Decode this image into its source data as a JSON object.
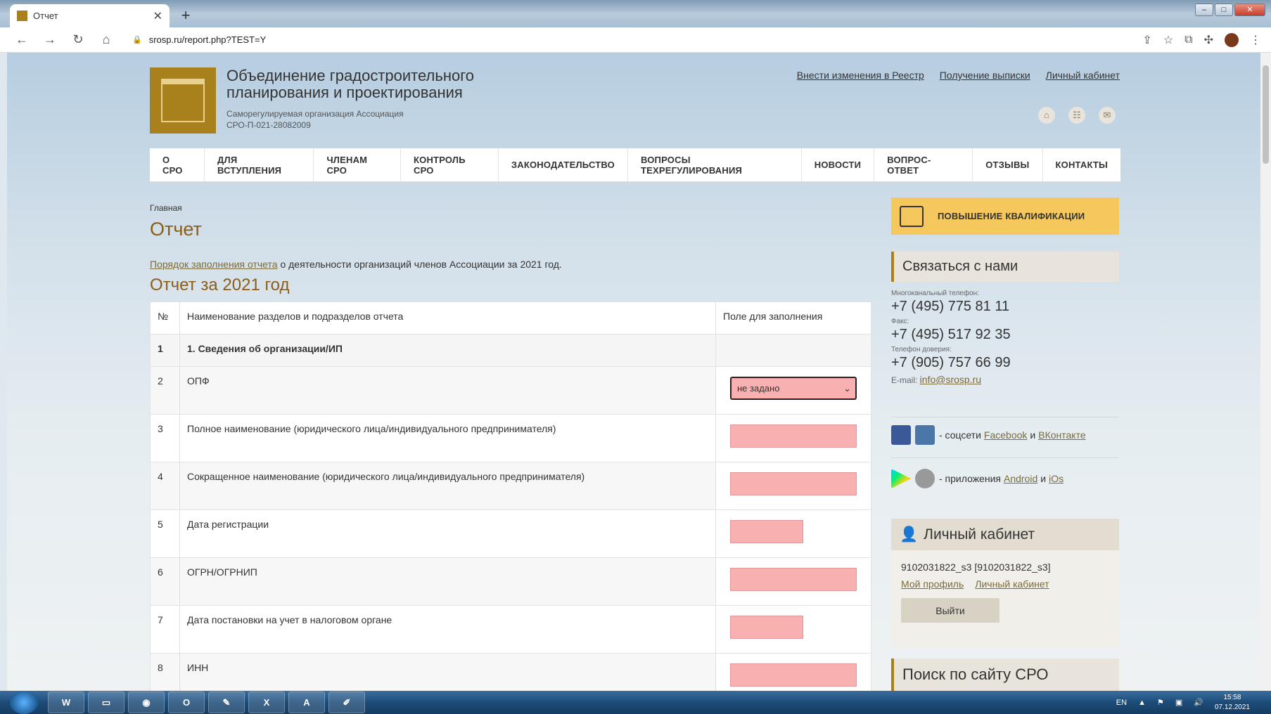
{
  "browser": {
    "tab_title": "Отчет",
    "url": "srosp.ru/report.php?TEST=Y"
  },
  "header": {
    "org_name": "Объединение градостроительного планирования и проектирования",
    "org_sub1": "Саморегулируемая организация Ассоциация",
    "org_sub2": "СРО-П-021-28082009",
    "links": [
      "Внести изменения в Реестр",
      "Получение выписки",
      "Личный кабинет"
    ]
  },
  "nav": [
    "О СРО",
    "ДЛЯ ВСТУПЛЕНИЯ",
    "ЧЛЕНАМ СРО",
    "КОНТРОЛЬ СРО",
    "ЗАКОНОДАТЕЛЬСТВО",
    "ВОПРОСЫ ТЕХРЕГУЛИРОВАНИЯ",
    "НОВОСТИ",
    "ВОПРОС-ОТВЕТ",
    "ОТЗЫВЫ",
    "КОНТАКТЫ"
  ],
  "breadcrumb": "Главная",
  "page_title": "Отчет",
  "intro_link": "Порядок заполнения отчета",
  "intro_text": " о деятельности организаций членов Ассоциации за 2021 год.",
  "report_title": "Отчет за 2021 год",
  "table": {
    "headers": [
      "№",
      "Наименование разделов и подразделов отчета",
      "Поле для заполнения"
    ],
    "section": {
      "num": "1",
      "label": "1. Сведения об организации/ИП"
    },
    "rows": [
      {
        "num": "2",
        "label": "ОПФ",
        "select_value": "не задано"
      },
      {
        "num": "3",
        "label": "Полное наименование (юридического лица/индивидуального предпринимателя)"
      },
      {
        "num": "4",
        "label": "Сокращенное наименование (юридического лица/индивидуального предпринимателя)"
      },
      {
        "num": "5",
        "label": "Дата регистрации"
      },
      {
        "num": "6",
        "label": "ОГРН/ОГРНИП"
      },
      {
        "num": "7",
        "label": "Дата постановки на учет в налоговом органе"
      },
      {
        "num": "8",
        "label": "ИНН"
      }
    ]
  },
  "sidebar": {
    "qualification": "ПОВЫШЕНИЕ КВАЛИФИКАЦИИ",
    "contact_title": "Связаться с нами",
    "phone_label": "Многоканальный телефон:",
    "phone": "+7 (495) 775 81 11",
    "fax_label": "Факс:",
    "fax": "+7 (495) 517 92 35",
    "trust_label": "Телефон доверия:",
    "trust": "+7 (905) 757 66 99",
    "email_label": "E-mail: ",
    "email": "info@srosp.ru",
    "social_text": "- соцсети",
    "facebook": "Facebook",
    "and": "и",
    "vk": "ВКонтакте",
    "apps_text": "- приложения",
    "android": "Android",
    "ios": "iOs",
    "cabinet_title": "Личный кабинет",
    "cabinet_user": "9102031822_s3 [9102031822_s3]",
    "my_profile": "Мой профиль",
    "cabinet_link": "Личный кабинет",
    "logout": "Выйти",
    "search_title": "Поиск по сайту СРО"
  },
  "taskbar": {
    "lang": "EN",
    "time": "15:58",
    "date": "07.12.2021"
  }
}
